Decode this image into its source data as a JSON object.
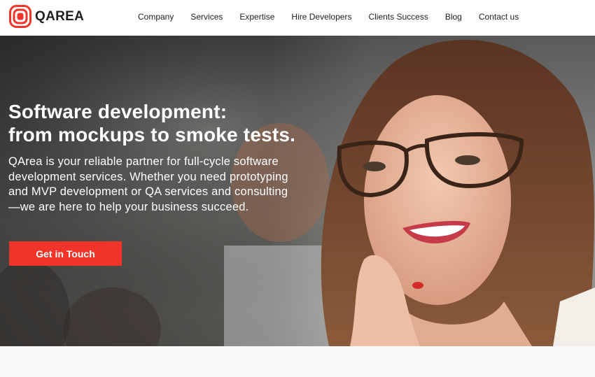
{
  "brand": {
    "name": "QAREA",
    "accent_color": "#f0342a",
    "logo_icon": "qarea-logo-icon"
  },
  "nav": {
    "items": [
      {
        "label": "Company"
      },
      {
        "label": "Services"
      },
      {
        "label": "Expertise"
      },
      {
        "label": "Hire Developers"
      },
      {
        "label": "Clients Success"
      },
      {
        "label": "Blog"
      },
      {
        "label": "Contact us"
      }
    ]
  },
  "hero": {
    "title_line1": "Software development:",
    "title_line2": "from mockups to smoke tests.",
    "description": "QArea is your reliable partner for full-cycle software development services. Whether you need prototyping and MVP development or QA services and consulting—we are here to help your business succeed.",
    "cta_label": "Get in Touch",
    "image": "woman-with-glasses-smiling-photo"
  }
}
